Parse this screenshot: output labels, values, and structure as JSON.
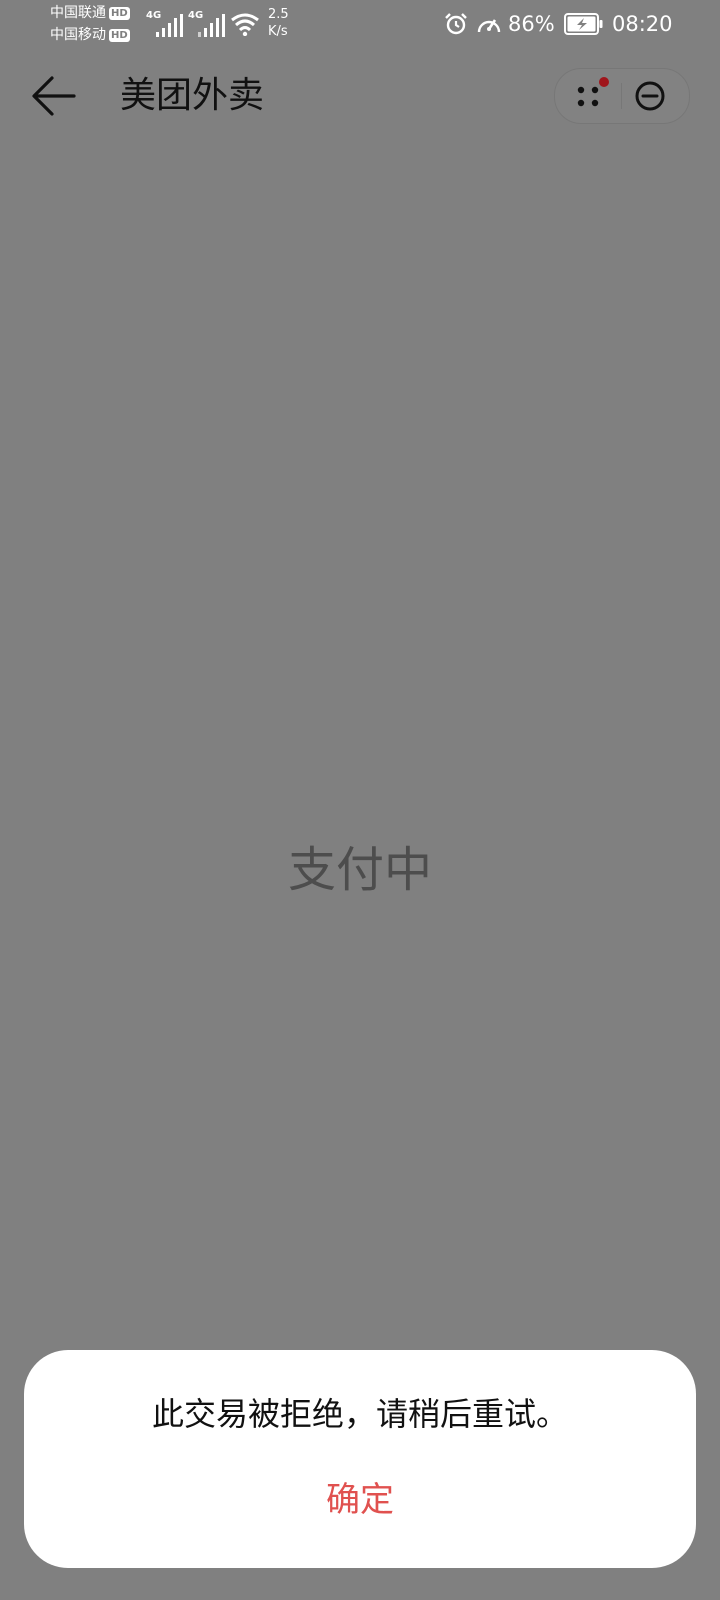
{
  "status_bar": {
    "carrier_1": "中国联通",
    "carrier_2": "中国移动",
    "hd_label": "HD",
    "network_type_1": "4G",
    "network_type_2": "4G",
    "net_speed_value": "2.5",
    "net_speed_unit": "K/s",
    "battery_percent": "86%",
    "time": "08:20"
  },
  "header": {
    "title": "美团外卖"
  },
  "main": {
    "loading_text": "支付中"
  },
  "dialog": {
    "message": "此交易被拒绝，请稍后重试。",
    "confirm_label": "确定"
  },
  "colors": {
    "overlay_background": "#808080",
    "confirm_text": "#e0514f",
    "badge_dot": "#a0151b"
  },
  "icons": {
    "back": "arrow-left-icon",
    "more": "four-dots-icon",
    "close": "minus-circle-icon",
    "alarm": "alarm-clock-icon",
    "speed": "speedometer-icon",
    "battery": "battery-charging-icon",
    "wifi": "wifi-icon",
    "signal": "signal-bars-icon"
  }
}
